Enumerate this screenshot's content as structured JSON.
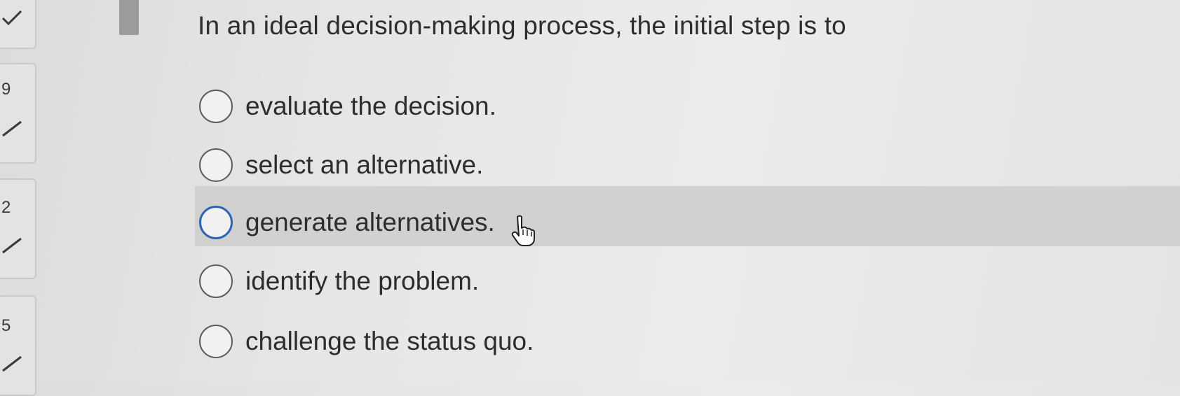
{
  "navigator": {
    "numbers": [
      "9",
      "2",
      "5"
    ]
  },
  "question": {
    "text": "In an ideal decision-making process, the initial step is to"
  },
  "options": [
    {
      "label": "evaluate the decision."
    },
    {
      "label": "select an alternative."
    },
    {
      "label": "generate alternatives."
    },
    {
      "label": "identify the problem."
    },
    {
      "label": "challenge the status quo."
    }
  ],
  "colors": {
    "radio_hover_border": "#2a65b8",
    "hover_band": "#d1d1cf"
  }
}
